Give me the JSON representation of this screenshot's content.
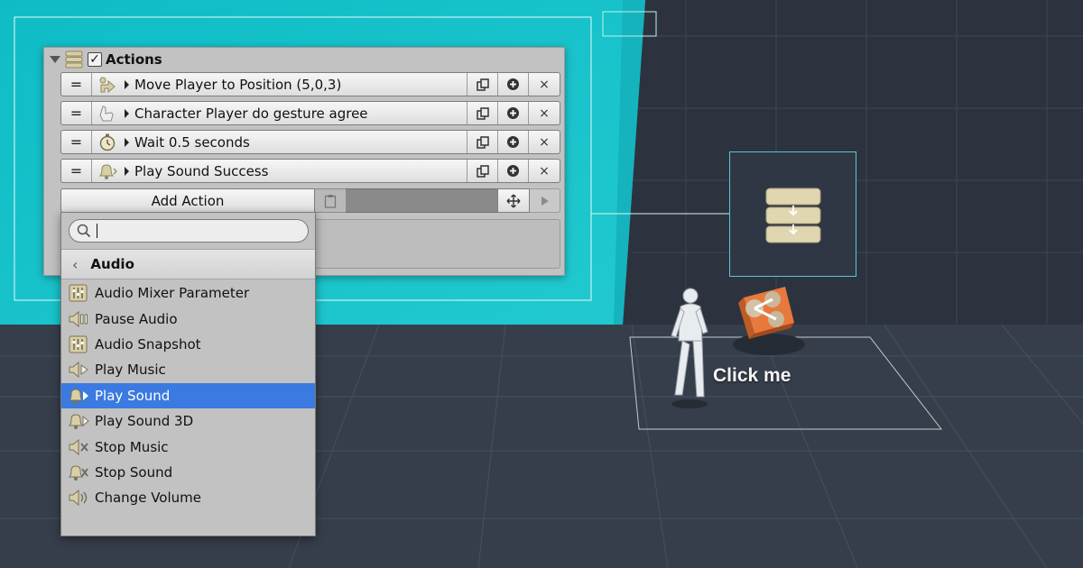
{
  "panel": {
    "title": "Actions",
    "enabled_check": "✓",
    "actions": [
      {
        "label": "Move Player to Position (5,0,3)",
        "icon": "move-arrow-icon"
      },
      {
        "label": "Character Player do gesture agree",
        "icon": "gesture-hand-icon"
      },
      {
        "label": "Wait 0.5 seconds",
        "icon": "stopwatch-icon"
      },
      {
        "label": "Play Sound Success",
        "icon": "bell-sound-icon"
      }
    ],
    "row_buttons": {
      "reorder": "=",
      "duplicate_icon": "duplicate-icon",
      "plus_icon": "plus-circle-icon",
      "remove": "×"
    },
    "add_action_label": "Add Action"
  },
  "dropdown": {
    "search": {
      "value": "",
      "placeholder": ""
    },
    "category": "Audio",
    "items": [
      {
        "label": "Audio Mixer Parameter",
        "icon": "mixer-icon"
      },
      {
        "label": "Pause Audio",
        "icon": "speaker-pause-icon"
      },
      {
        "label": "Audio Snapshot",
        "icon": "mixer-icon"
      },
      {
        "label": "Play Music",
        "icon": "speaker-play-icon"
      },
      {
        "label": "Play Sound",
        "icon": "bell-play-icon",
        "selected": true
      },
      {
        "label": "Play Sound 3D",
        "icon": "bell-play-icon"
      },
      {
        "label": "Stop Music",
        "icon": "speaker-stop-icon"
      },
      {
        "label": "Stop Sound",
        "icon": "bell-stop-icon"
      },
      {
        "label": "Change Volume",
        "icon": "speaker-volume-icon"
      }
    ]
  },
  "scene": {
    "click_label": "Click me"
  },
  "colors": {
    "cyan_backdrop": "#19c8cf",
    "selection": "#3b7ae0",
    "panel_bg": "#c2c2c2",
    "scene_floor": "#353d4a"
  }
}
